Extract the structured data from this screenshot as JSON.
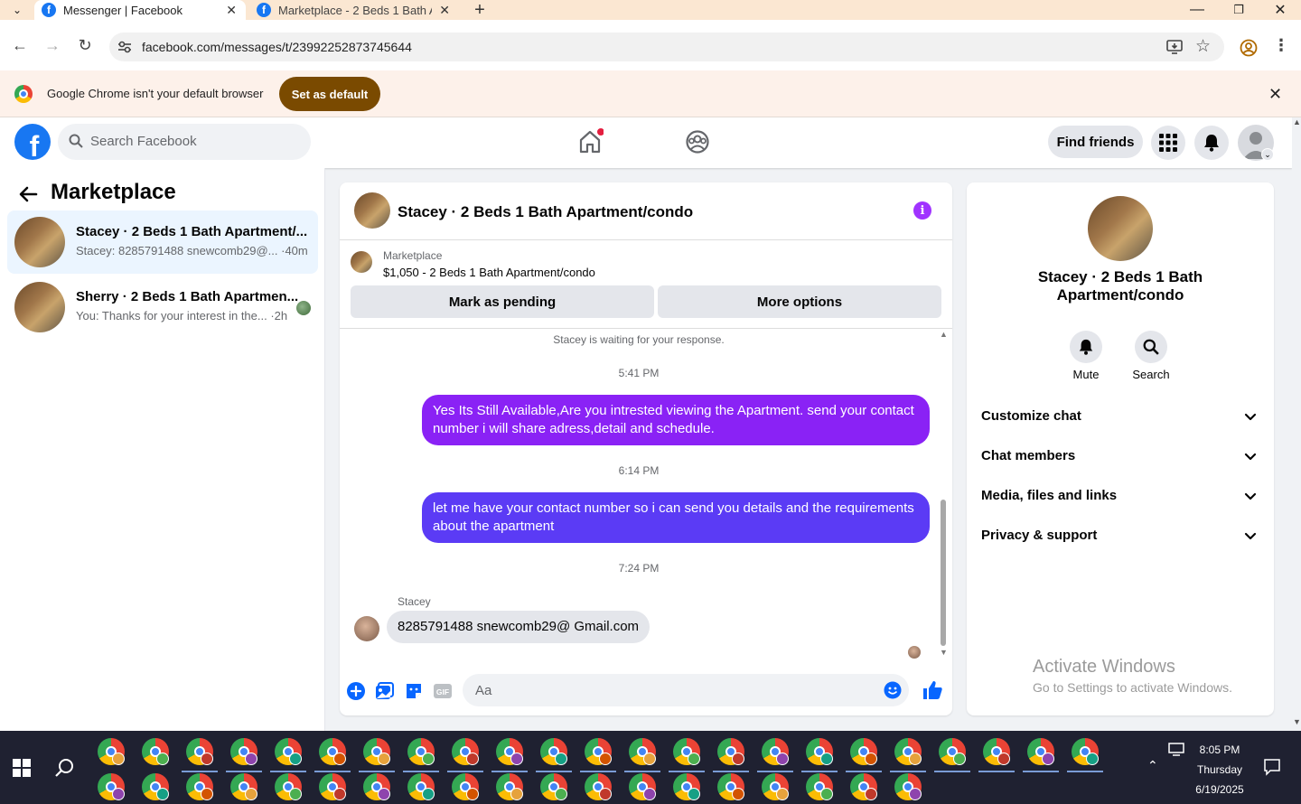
{
  "browser": {
    "tabs": [
      {
        "title": "Messenger | Facebook",
        "active": true
      },
      {
        "title": "Marketplace - 2 Beds 1 Bath Ap",
        "active": false
      }
    ],
    "url": "facebook.com/messages/t/23992252873745644",
    "banner": {
      "message": "Google Chrome isn't your default browser",
      "button": "Set as default"
    }
  },
  "fb_header": {
    "search_placeholder": "Search Facebook",
    "find_friends": "Find friends",
    "home_has_notification": true
  },
  "sidebar": {
    "title": "Marketplace",
    "conversations": [
      {
        "name": "Stacey · 2 Beds 1 Bath Apartment/...",
        "preview": "Stacey: 8285791488 snewcomb29@... ·40m",
        "selected": true
      },
      {
        "name": "Sherry · 2 Beds 1 Bath Apartmen...",
        "preview": "You: Thanks for your interest in the... ·2h",
        "selected": false
      }
    ]
  },
  "chat": {
    "title": "Stacey · 2 Beds 1 Bath Apartment/condo",
    "listing": {
      "label": "Marketplace",
      "price_title": "$1,050 - 2 Beds 1 Bath Apartment/condo",
      "mark_pending": "Mark as pending",
      "more_options": "More options"
    },
    "status": "Stacey is waiting for your response.",
    "messages": [
      {
        "time": "5:41 PM",
        "from": "me",
        "text": "Yes Its Still Available,Are you intrested viewing the Apartment. send your contact number i will share adress,detail and schedule."
      },
      {
        "time": "6:14 PM",
        "from": "me",
        "text": "let me have your contact number so i can send you details and the requirements about the apartment"
      },
      {
        "time": "7:24 PM",
        "from": "Stacey",
        "text": "8285791488 snewcomb29@ Gmail.com"
      }
    ],
    "composer_placeholder": "Aa",
    "colors": {
      "bubble_1": "#8a22f5",
      "bubble_2": "#5b3bf5",
      "accent": "#0866ff"
    }
  },
  "info_panel": {
    "name": "Stacey · 2 Beds 1 Bath Apartment/condo",
    "actions": [
      {
        "label": "Mute",
        "icon": "bell-icon"
      },
      {
        "label": "Search",
        "icon": "search-icon"
      }
    ],
    "sections": [
      "Customize chat",
      "Chat members",
      "Media, files and links",
      "Privacy & support"
    ]
  },
  "watermark": {
    "line1": "Activate Windows",
    "line2": "Go to Settings to activate Windows."
  },
  "taskbar": {
    "time": "8:05 PM",
    "day": "Thursday",
    "date": "6/19/2025"
  }
}
